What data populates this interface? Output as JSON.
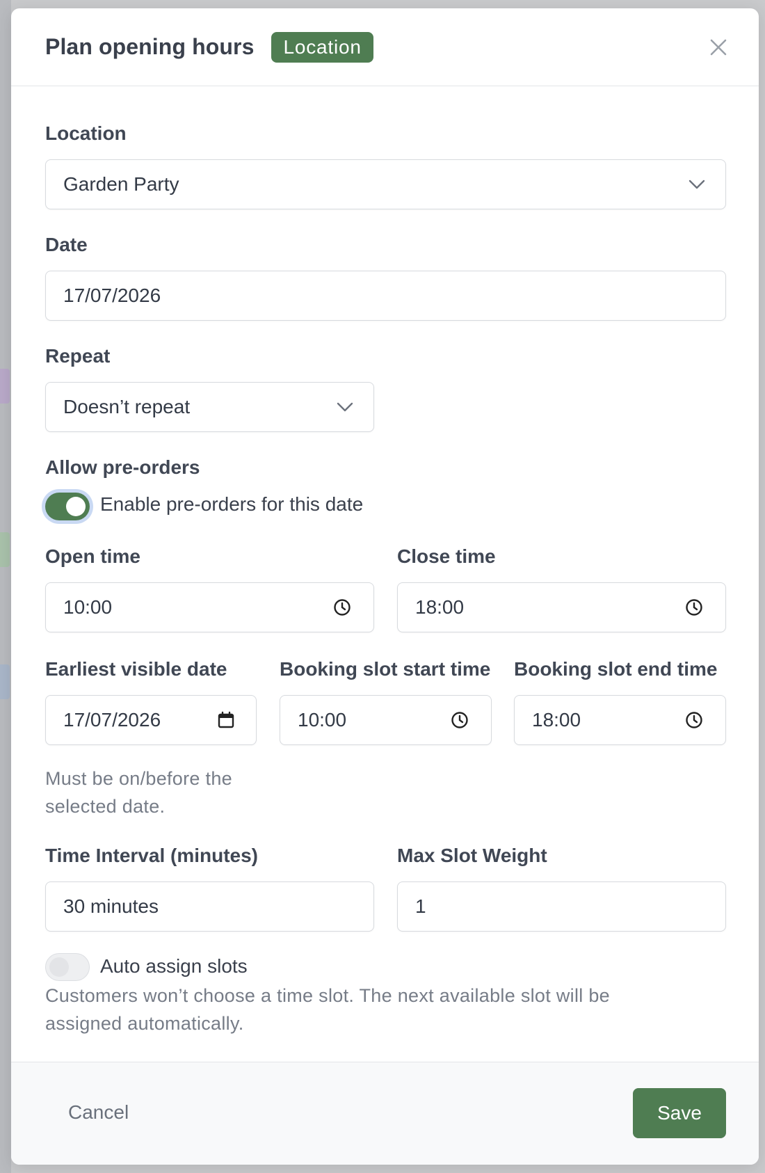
{
  "modal": {
    "title": "Plan opening hours",
    "badge": "Location"
  },
  "form": {
    "location": {
      "label": "Location",
      "value": "Garden Party"
    },
    "date": {
      "label": "Date",
      "value": "17/07/2026"
    },
    "repeat": {
      "label": "Repeat",
      "value": "Doesn’t repeat"
    },
    "pre_orders": {
      "label": "Allow pre-orders",
      "toggle_label": "Enable pre-orders for this date",
      "enabled": true
    },
    "open_time": {
      "label": "Open time",
      "value": "10:00"
    },
    "close_time": {
      "label": "Close time",
      "value": "18:00"
    },
    "earliest_visible_date": {
      "label": "Earliest visible date",
      "value": "17/07/2026",
      "help_line1": "Must be on/before the",
      "help_line2": "selected date."
    },
    "booking_slot_start": {
      "label": "Booking slot start time",
      "value": "10:00"
    },
    "booking_slot_end": {
      "label": "Booking slot end time",
      "value": "18:00"
    },
    "time_interval": {
      "label": "Time Interval (minutes)",
      "value": "30 minutes"
    },
    "max_slot_weight": {
      "label": "Max Slot Weight",
      "value": "1"
    },
    "auto_assign": {
      "toggle_label": "Auto assign slots",
      "enabled": false,
      "help_line1": "Customers won’t choose a time slot. The next available slot will be",
      "help_line2": "assigned automatically."
    }
  },
  "footer": {
    "cancel_label": "Cancel",
    "save_label": "Save"
  },
  "colors": {
    "accent": "#4f7d52",
    "focus_ring": "#c9d9f3",
    "backdrop": "#c9cacc"
  }
}
